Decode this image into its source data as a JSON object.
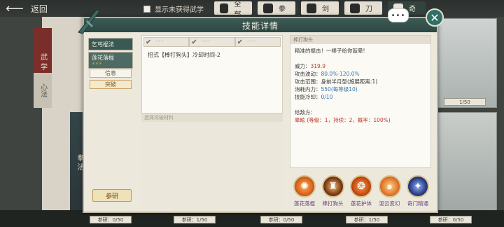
{
  "topbar": {
    "back_label": "返回",
    "show_unowned_label": "显示未获得武学",
    "filters": [
      {
        "label": "全部",
        "icon": "bag-icon"
      },
      {
        "label": "拳",
        "icon": "fist-icon"
      },
      {
        "label": "剑",
        "icon": "sword-icon"
      },
      {
        "label": "刀",
        "icon": "blade-icon"
      },
      {
        "label": "奇",
        "icon": "odd-weapon-icon"
      }
    ]
  },
  "background": {
    "left_tab": "武学",
    "left_tab2": "心法",
    "side_label": "拳法",
    "progress_labels": [
      "参研：0/50",
      "参研：1/50",
      "参研：0/50",
      "参研：1/50",
      "参研：0/50"
    ],
    "top_progress": [
      "1/50",
      "1/50"
    ]
  },
  "modal": {
    "title": "技能详情",
    "chat_bubble": "•••",
    "close_symbol": "✕",
    "left": {
      "tabs": [
        {
          "label": "乞丐棍法"
        },
        {
          "label": "莲花落棍",
          "stars": "⚡⚡⚡"
        }
      ],
      "sub_buttons": [
        "信息",
        "突破"
      ],
      "research_button": "参研"
    },
    "center": {
      "slots": [
        {
          "check": "✔",
          "marks": "ᐟᐟᐟ"
        },
        {
          "check": "✔",
          "marks": "ᐟᐟᐟ"
        },
        {
          "check": "✔",
          "marks": "ᐟᐟᐟ"
        }
      ],
      "move_text": "招式【棒打狗头】冷却时间-2",
      "material_label": "选择突破材料"
    },
    "info": {
      "header": "棒打狗头",
      "desc": "精准的棍击！一棒子给你敲晕!",
      "stats": [
        {
          "k": "威力：",
          "v": "319.9",
          "cls": "red"
        },
        {
          "k": "攻击波动：",
          "v": "80.0%-120.0%",
          "cls": "blue"
        },
        {
          "k": "攻击范围：",
          "v": "身前半月型(施展距离:1)",
          "cls": ""
        },
        {
          "k": "消耗内力：",
          "v": "550",
          "extra": "(每等级10)",
          "cls": "blue"
        },
        {
          "k": "技能冷却：",
          "v": "0/10",
          "cls": "blue"
        }
      ],
      "effect_title": "给敌方：",
      "effect_text": "晕眩 (等级：1，持续：2，概率：100%)"
    },
    "skills": [
      {
        "name": "莲花落棍",
        "color": "#d9601e"
      },
      {
        "name": "棒打狗头",
        "color": "#7b3a16"
      },
      {
        "name": "莲花护体",
        "color": "#c84a12"
      },
      {
        "name": "泥云变幻",
        "color": "#e1762a"
      },
      {
        "name": "奇门精通",
        "color": "#2b3b86"
      }
    ]
  }
}
